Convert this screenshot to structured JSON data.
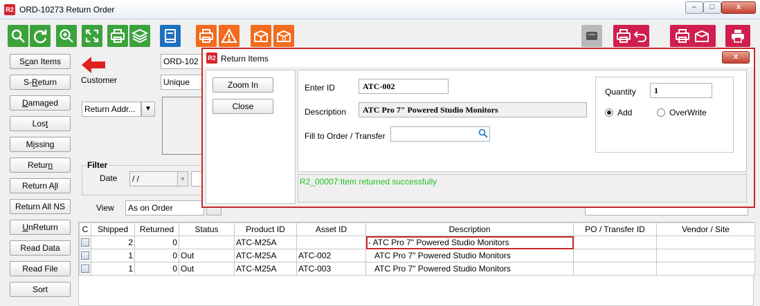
{
  "window": {
    "title": "ORD-10273 Return Order",
    "logo": "R2",
    "min": "–",
    "max": "□",
    "close": "x"
  },
  "toolbar": {
    "icons": [
      "search-icon",
      "refresh-icon",
      "zoom-in-icon",
      "expand-icon",
      "print-icon",
      "layers-icon",
      "book-icon",
      "print-icon",
      "warning-icon",
      "open-box-icon",
      "box-m-icon",
      "printer-device-icon",
      "print-undo-icon",
      "print-box-icon",
      "printer-red-icon"
    ]
  },
  "sidebar": {
    "items": [
      {
        "label": "Scan Items",
        "u": "c"
      },
      {
        "label": "S-Return",
        "u": "R"
      },
      {
        "label": "Damaged",
        "u": "D"
      },
      {
        "label": "Lost",
        "u": "t"
      },
      {
        "label": "Missing",
        "u": "i"
      },
      {
        "label": "Return",
        "u": "n"
      },
      {
        "label": "Return All",
        "u": "l"
      },
      {
        "label": "Return All NS",
        "u": ""
      },
      {
        "label": "UnReturn",
        "u": "U"
      },
      {
        "label": "Read Data",
        "u": ""
      },
      {
        "label": "Read File",
        "u": ""
      },
      {
        "label": "Sort",
        "u": ""
      }
    ]
  },
  "main": {
    "order_id": "ORD-102",
    "customer_label": "Customer",
    "customer_value": "Unique",
    "return_address": "Return Addr...",
    "filter_label": "Filter",
    "date_label": "Date",
    "date_value": "/ /",
    "view_label": "View",
    "view_value": "As on Order"
  },
  "table": {
    "headers": [
      "C",
      "Shipped",
      "Returned",
      "Status",
      "Product ID",
      "Asset ID",
      "Description",
      "PO / Transfer ID",
      "Vendor / Site"
    ],
    "rows": [
      {
        "shipped": "2",
        "returned": "0",
        "status": "",
        "product": "ATC-M25A",
        "asset": "",
        "desc": "- ATC Pro 7\" Powered Studio Monitors",
        "po": "",
        "vendor": ""
      },
      {
        "shipped": "1",
        "returned": "0",
        "status": "Out",
        "product": "ATC-M25A",
        "asset": "ATC-002",
        "desc": "ATC Pro 7\" Powered Studio Monitors",
        "po": "",
        "vendor": ""
      },
      {
        "shipped": "1",
        "returned": "0",
        "status": "Out",
        "product": "ATC-M25A",
        "asset": "ATC-003",
        "desc": "ATC Pro 7\" Powered Studio Monitors",
        "po": "",
        "vendor": ""
      }
    ]
  },
  "dialog": {
    "title": "Return Items",
    "logo": "R2",
    "close": "x",
    "zoom_in": "Zoom In",
    "close_btn": "Close",
    "enter_id_label": "Enter ID",
    "enter_id_value": "ATC-002",
    "description_label": "Description",
    "description_value": "ATC Pro 7\" Powered Studio Monitors",
    "fill_label": "Fill to Order / Transfer",
    "fill_value": "",
    "quantity_label": "Quantity",
    "quantity_value": "1",
    "add_label": "Add",
    "overwrite_label": "OverWrite",
    "status_message": "R2_00007:Item returned successfully"
  },
  "colors": {
    "green": "#3ca23c",
    "blue": "#1d6fc0",
    "orange": "#f26b1e",
    "red": "#d01e4e",
    "success_text": "#22c01e",
    "accent_red": "#c62828"
  }
}
